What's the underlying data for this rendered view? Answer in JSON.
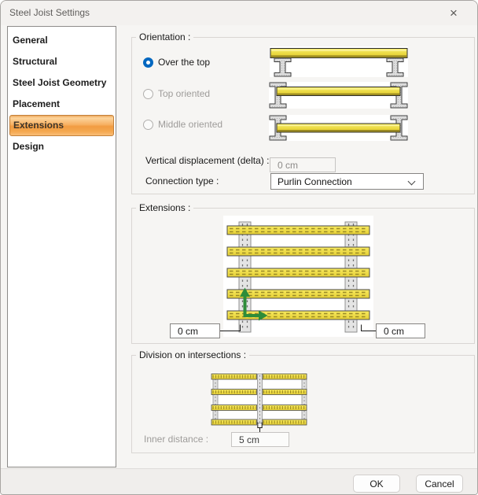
{
  "window": {
    "title": "Steel Joist Settings",
    "close_icon": "×"
  },
  "sidebar": {
    "items": [
      {
        "label": "General",
        "selected": false
      },
      {
        "label": "Structural",
        "selected": false
      },
      {
        "label": "Steel Joist Geometry",
        "selected": false
      },
      {
        "label": "Placement",
        "selected": false
      },
      {
        "label": "Extensions",
        "selected": true
      },
      {
        "label": "Design",
        "selected": false
      }
    ]
  },
  "orientation": {
    "legend": "Orientation :",
    "radios": [
      {
        "label": "Over the top",
        "selected": true,
        "enabled": true
      },
      {
        "label": "Top oriented",
        "selected": false,
        "enabled": false
      },
      {
        "label": "Middle oriented",
        "selected": false,
        "enabled": false
      }
    ],
    "vertical_displacement_label": "Vertical displacement (delta) :",
    "vertical_displacement_value": "0 cm",
    "connection_type_label": "Connection type :",
    "connection_type_value": "Purlin Connection"
  },
  "extensions": {
    "legend": "Extensions :",
    "left_extension_value": "0 cm",
    "right_extension_value": "0 cm"
  },
  "division": {
    "legend": "Division on intersections :",
    "inner_distance_label": "Inner distance :",
    "inner_distance_value": "5 cm"
  },
  "footer": {
    "ok_label": "OK",
    "cancel_label": "Cancel"
  },
  "colors": {
    "selection_orange": "#f19c42",
    "radio_blue": "#0067c0",
    "joist_yellow": "#eed93f",
    "arrow_green": "#2e8c39",
    "steel_gray": "#e0e0e0"
  }
}
